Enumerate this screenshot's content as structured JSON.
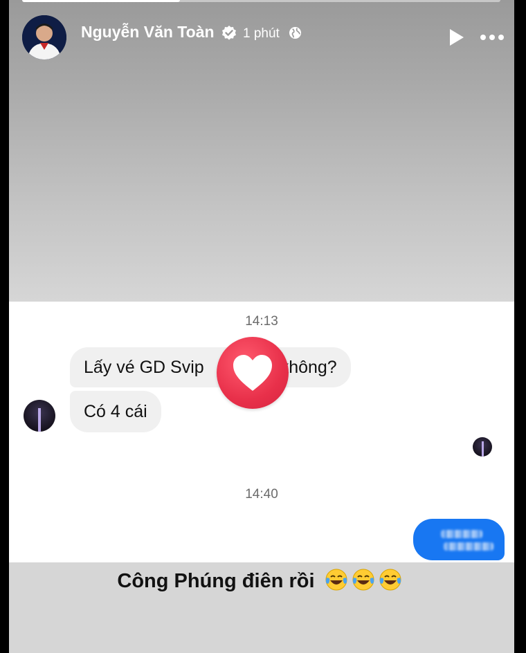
{
  "story": {
    "progress": 0.33,
    "author_name": "Nguyễn Văn Toàn",
    "verified_icon": "verified-badge-icon",
    "time_label": "1 phút",
    "privacy_icon": "globe-icon",
    "controls": {
      "play_icon": "play-icon",
      "more_icon": "more-options-icon"
    }
  },
  "chat": {
    "timestamp_1": "14:13",
    "message_1_part_a": "Lấy vé GD Svip",
    "message_1_part_b": "không?",
    "message_2": "Có 4 cái",
    "reaction_icon": "heart-reaction-icon",
    "timestamp_2": "14:40"
  },
  "caption": {
    "text": "Công Phúng điên rồi",
    "emoji": "😂😂😂"
  },
  "colors": {
    "reaction": "#e8304a",
    "sent_bubble": "#1877f2",
    "received_bubble": "#f0f0f0"
  }
}
